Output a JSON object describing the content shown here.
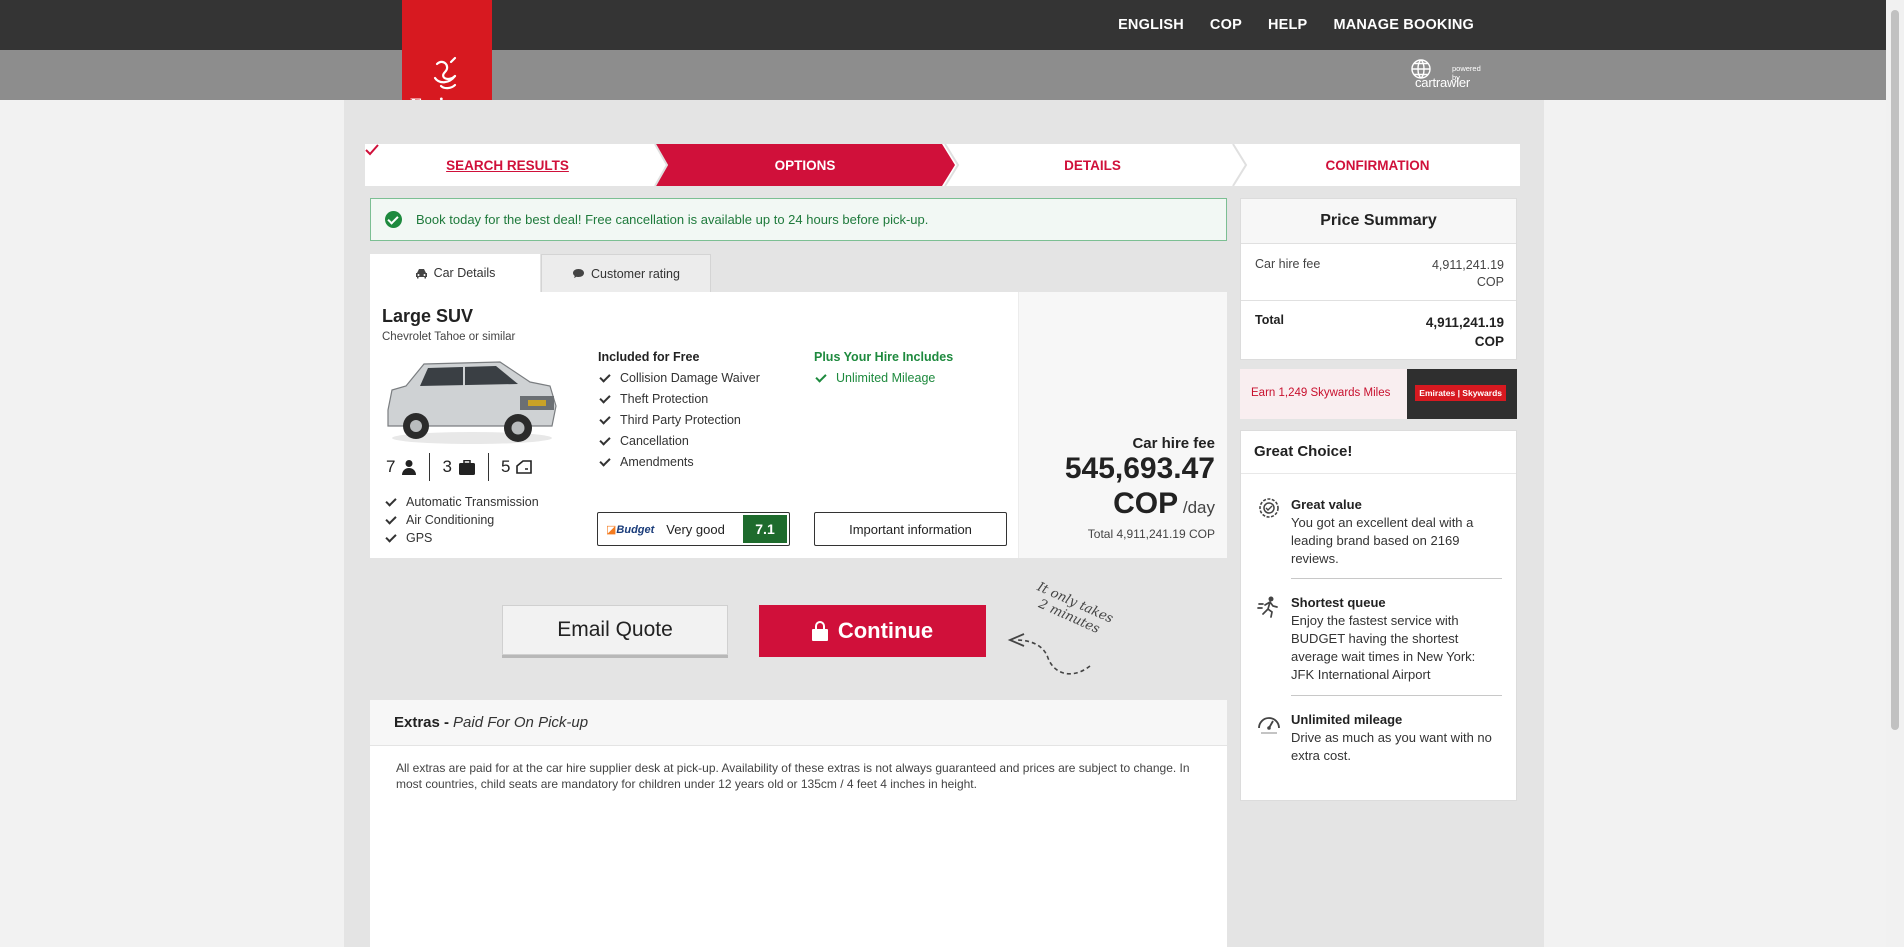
{
  "header": {
    "nav": [
      "ENGLISH",
      "COP",
      "HELP",
      "MANAGE BOOKING"
    ],
    "logo_text": "Emirates",
    "powered_by": "powered by",
    "partner": "cartrawler"
  },
  "steps": [
    {
      "label": "SEARCH RESULTS",
      "state": "done"
    },
    {
      "label": "OPTIONS",
      "state": "active"
    },
    {
      "label": "DETAILS",
      "state": "todo"
    },
    {
      "label": "CONFIRMATION",
      "state": "todo"
    }
  ],
  "notice": "Book today for the best deal! Free cancellation is available up to 24 hours before pick-up.",
  "tabs": {
    "car_details": "Car Details",
    "customer_rating": "Customer rating"
  },
  "car": {
    "class": "Large SUV",
    "model": "Chevrolet Tahoe or similar",
    "seats": "7",
    "bags": "3",
    "doors": "5",
    "features": [
      "Automatic Transmission",
      "Air Conditioning",
      "GPS"
    ],
    "included_title": "Included for Free",
    "included": [
      "Collision Damage Waiver",
      "Theft Protection",
      "Third Party Protection",
      "Cancellation",
      "Amendments"
    ],
    "plus_title": "Plus Your Hire Includes",
    "plus": [
      "Unlimited Mileage"
    ],
    "supplier": "Budget",
    "rating_text": "Very good",
    "rating_score": "7.1",
    "important_btn": "Important information",
    "fee_label": "Car hire fee",
    "fee_amount": "545,693.47",
    "fee_currency": "COP",
    "fee_unit": "/day",
    "fee_total": "Total 4,911,241.19 COP"
  },
  "actions": {
    "email": "Email Quote",
    "continue": "Continue",
    "hint": "It only takes 2 minutes"
  },
  "extras": {
    "title": "Extras -",
    "subtitle": "Paid For On Pick-up",
    "body": "All extras are paid for at the car hire supplier desk at pick-up. Availability of these extras is not always guaranteed and prices are subject to change. In most countries, child seats are mandatory for children under 12 years old or 135cm / 4 feet 4 inches in height."
  },
  "price_summary": {
    "title": "Price Summary",
    "hire_label": "Car hire fee",
    "hire_value": "4,911,241.19",
    "hire_cur": "COP",
    "total_label": "Total",
    "total_value": "4,911,241.19",
    "total_cur": "COP"
  },
  "skywards": {
    "text": "Earn 1,249 Skywards Miles",
    "badge": "Emirates | Skywards"
  },
  "great_choice": {
    "title": "Great Choice!",
    "items": [
      {
        "title": "Great value",
        "text": "You got an excellent deal with a leading brand based on 2169 reviews.",
        "icon": "badge-icon"
      },
      {
        "title": "Shortest queue",
        "text": "Enjoy the fastest service with BUDGET having the shortest average wait times in New York: JFK International Airport",
        "icon": "runner-icon"
      },
      {
        "title": "Unlimited mileage",
        "text": "Drive as much as you want with no extra cost.",
        "icon": "speedometer-icon"
      }
    ]
  }
}
